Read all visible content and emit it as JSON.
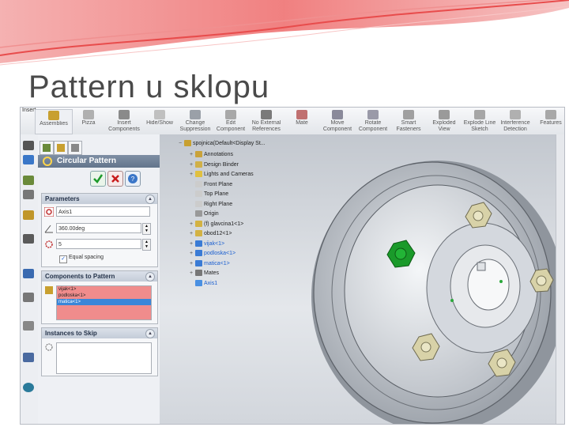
{
  "slide": {
    "title": "Pattern u sklopu"
  },
  "toolbar": {
    "tab_label": "Insert",
    "items": [
      {
        "label": "Assemblies",
        "icon": "assembly-icon"
      },
      {
        "label": "Pizza",
        "icon": "pizza-icon"
      },
      {
        "label": "Insert Components",
        "icon": "insert-components-icon"
      },
      {
        "label": "Hide/Show",
        "icon": "hide-show-icon"
      },
      {
        "label": "Change Suppression",
        "icon": "change-suppression-icon"
      },
      {
        "label": "Edit Component",
        "icon": "edit-component-icon"
      },
      {
        "label": "No External References",
        "icon": "no-external-references-icon"
      },
      {
        "label": "Mate",
        "icon": "mate-icon"
      },
      {
        "label": "Move Component",
        "icon": "move-component-icon"
      },
      {
        "label": "Rotate Component",
        "icon": "rotate-component-icon"
      },
      {
        "label": "Smart Fasteners",
        "icon": "smart-fasteners-icon"
      },
      {
        "label": "Exploded View",
        "icon": "exploded-view-icon"
      },
      {
        "label": "Explode Line Sketch",
        "icon": "explode-line-sketch-icon"
      },
      {
        "label": "Interference Detection",
        "icon": "interference-detection-icon"
      },
      {
        "label": "Features",
        "icon": "features-icon"
      }
    ]
  },
  "property_manager": {
    "title": "Circular Pattern",
    "ok_icon": "checkmark-icon",
    "cancel_icon": "cancel-icon",
    "help_icon": "help-icon",
    "parameters": {
      "header": "Parameters",
      "axis_value": "Axis1",
      "angle_value": "360.00deg",
      "instances_value": "5",
      "equal_spacing_label": "Equal spacing",
      "equal_spacing_checked": true
    },
    "components": {
      "header": "Components to Pattern",
      "items": [
        "vijak<1>",
        "podloska<1>",
        "matica<1>"
      ],
      "selected_index": 2
    },
    "skip": {
      "header": "Instances to Skip"
    }
  },
  "feature_tree": {
    "root": "spojnica(Default<Display St...",
    "nodes": [
      {
        "label": "Annotations",
        "indent": 1,
        "icon_color": "#c9a23a",
        "expand": "+"
      },
      {
        "label": "Design Binder",
        "indent": 1,
        "icon_color": "#d0b048",
        "expand": "+"
      },
      {
        "label": "Lights and Cameras",
        "indent": 1,
        "icon_color": "#e0c040",
        "expand": "+"
      },
      {
        "label": "Front Plane",
        "indent": 1,
        "icon_color": "#cccccc",
        "expand": ""
      },
      {
        "label": "Top Plane",
        "indent": 1,
        "icon_color": "#cccccc",
        "expand": ""
      },
      {
        "label": "Right Plane",
        "indent": 1,
        "icon_color": "#cccccc",
        "expand": ""
      },
      {
        "label": "Origin",
        "indent": 1,
        "icon_color": "#999999",
        "expand": ""
      },
      {
        "label": "(f) glavcina1<1>",
        "indent": 1,
        "icon_color": "#d3b243",
        "expand": "+"
      },
      {
        "label": "obod12<1>",
        "indent": 1,
        "icon_color": "#d3b243",
        "expand": "+"
      },
      {
        "label": "vijak<1>",
        "indent": 1,
        "icon_color": "#3a7bd5",
        "expand": "+",
        "highlight": true
      },
      {
        "label": "podloska<1>",
        "indent": 1,
        "icon_color": "#3a7bd5",
        "expand": "+",
        "highlight": true
      },
      {
        "label": "matica<1>",
        "indent": 1,
        "icon_color": "#3a7bd5",
        "expand": "+",
        "highlight": true
      },
      {
        "label": "Mates",
        "indent": 1,
        "icon_color": "#777777",
        "expand": "+"
      },
      {
        "label": "Axis1",
        "indent": 1,
        "icon_color": "#4a90e2",
        "expand": "",
        "highlight": true
      }
    ]
  },
  "colors": {
    "banner_red": "#e83a3a",
    "banner_pink": "#f6c8c8",
    "title_gray": "#4a4a4a",
    "tree_highlight": "#1a5fd0",
    "list_pink": "#f08c8c",
    "list_selected": "#3a86d8",
    "part_green": "#1a9a2a",
    "bolt_tan": "#d8d2a8"
  }
}
